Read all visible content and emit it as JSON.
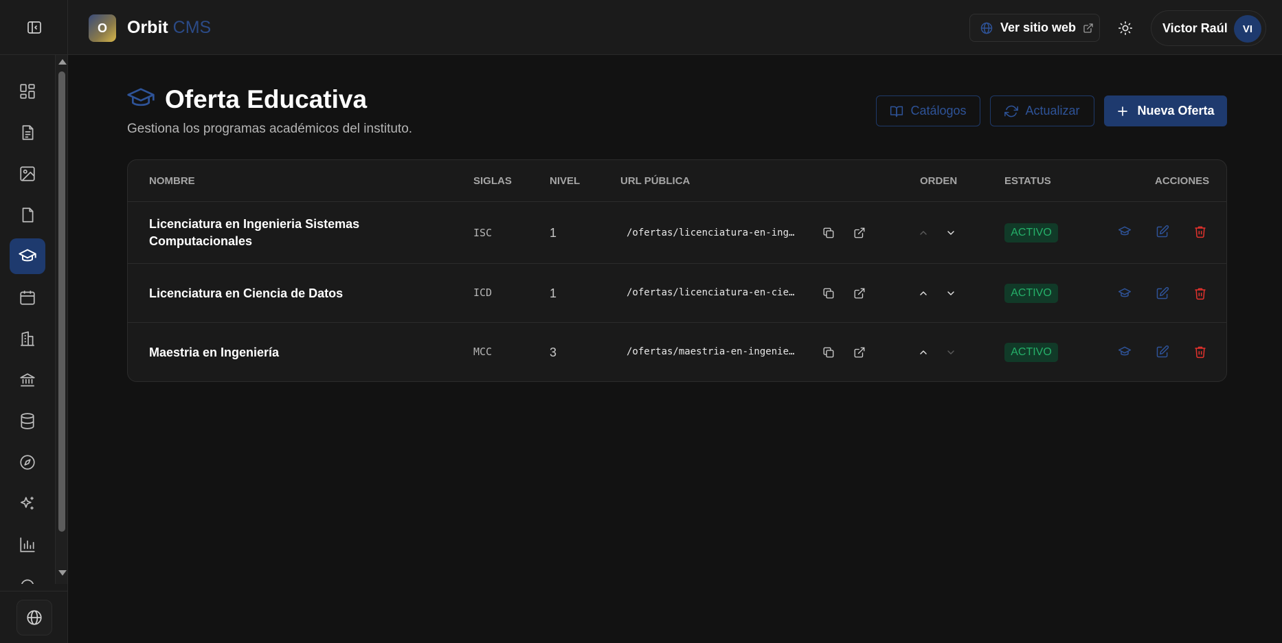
{
  "app": {
    "brand": "Orbit",
    "brand_suffix": "CMS",
    "logo_letter": "O"
  },
  "header": {
    "site_button": "Ver sitio web",
    "user_name": "Victor Raúl",
    "user_initials": "VI"
  },
  "sidebar": {
    "items": [
      {
        "icon": "dashboard-icon"
      },
      {
        "icon": "document-icon"
      },
      {
        "icon": "image-icon"
      },
      {
        "icon": "file-icon"
      },
      {
        "icon": "graduation-cap-icon",
        "active": true
      },
      {
        "icon": "calendar-icon"
      },
      {
        "icon": "building-icon"
      },
      {
        "icon": "institution-icon"
      },
      {
        "icon": "database-icon"
      },
      {
        "icon": "compass-icon"
      },
      {
        "icon": "sparkles-icon"
      },
      {
        "icon": "bar-chart-icon"
      }
    ],
    "bottom_icon": "globe-icon"
  },
  "page": {
    "title": "Oferta Educativa",
    "subtitle": "Gestiona los programas académicos del instituto.",
    "buttons": {
      "catalogos": "Catálogos",
      "actualizar": "Actualizar",
      "nueva": "Nueva Oferta"
    }
  },
  "table": {
    "headers": {
      "nombre": "NOMBRE",
      "siglas": "SIGLAS",
      "nivel": "NIVEL",
      "url": "URL PÚBLICA",
      "orden": "ORDEN",
      "estatus": "ESTATUS",
      "acciones": "ACCIONES"
    },
    "rows": [
      {
        "nombre": "Licenciatura en Ingenieria Sistemas Computacionales",
        "siglas": "ISC",
        "nivel": "1",
        "url": "/ofertas/licenciatura-en-ingenieria-sistemas-computacionales",
        "estatus": "ACTIVO"
      },
      {
        "nombre": "Licenciatura en Ciencia de Datos",
        "siglas": "ICD",
        "nivel": "1",
        "url": "/ofertas/licenciatura-en-ciencia-de-datos",
        "estatus": "ACTIVO"
      },
      {
        "nombre": "Maestria en Ingeniería",
        "siglas": "MCC",
        "nivel": "3",
        "url": "/ofertas/maestria-en-ingenieria",
        "estatus": "ACTIVO"
      }
    ]
  },
  "colors": {
    "accent": "#1e3a6e",
    "accent_text": "#2e5398",
    "active_badge_bg": "#113a28",
    "active_badge_text": "#25b069",
    "delete": "#e5322d"
  }
}
